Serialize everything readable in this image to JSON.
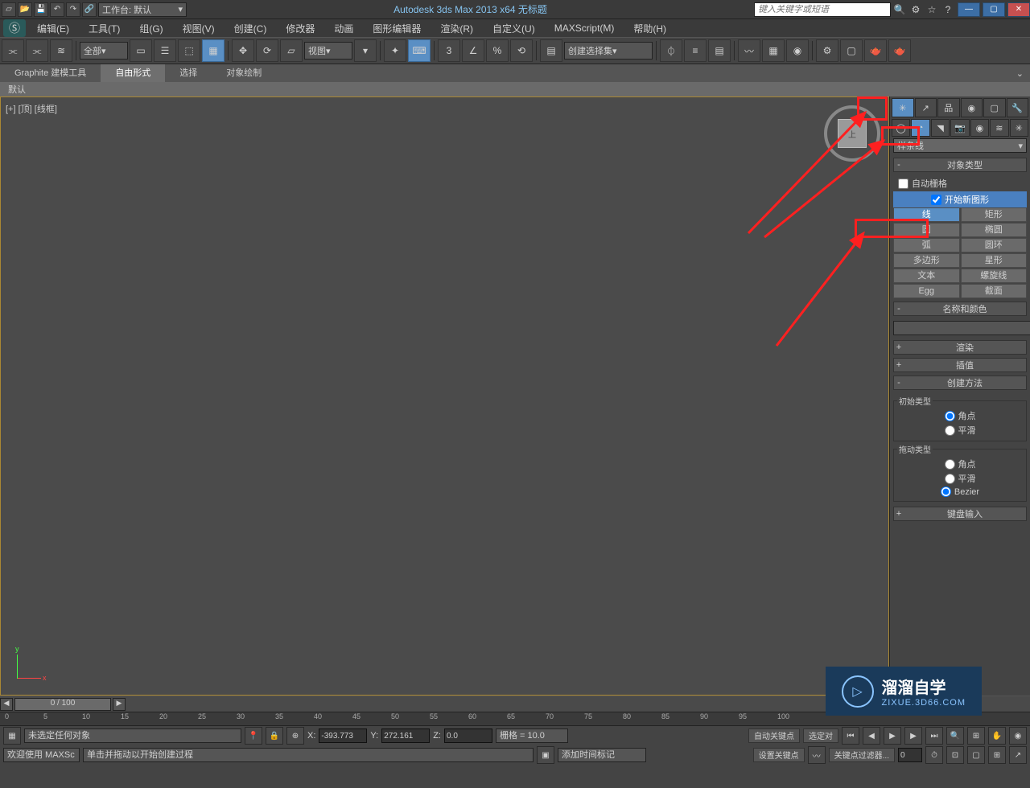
{
  "titlebar": {
    "workspace_label": "工作台: 默认",
    "app_title": "Autodesk 3ds Max  2013 x64     无标题",
    "search_placeholder": "键入关键字或短语"
  },
  "menubar": {
    "items": [
      "编辑(E)",
      "工具(T)",
      "组(G)",
      "视图(V)",
      "创建(C)",
      "修改器",
      "动画",
      "图形编辑器",
      "渲染(R)",
      "自定义(U)",
      "MAXScript(M)",
      "帮助(H)"
    ]
  },
  "toolbar": {
    "filter_all": "全部",
    "view_dd": "视图",
    "selset_dd": "创建选择集"
  },
  "ribbon": {
    "tabs": [
      "Graphite 建模工具",
      "自由形式",
      "选择",
      "对象绘制"
    ],
    "sub": "默认"
  },
  "viewport": {
    "label": "[+] [顶] [线框]",
    "cube_face": "上"
  },
  "panel": {
    "category_dd": "样条线",
    "rollouts": {
      "objtype": "对象类型",
      "autogrid": "自动栅格",
      "startnew": "开始新图形",
      "namecolor": "名称和颜色",
      "render": "渲染",
      "interp": "插值",
      "create_method": "创建方法",
      "keyboard": "键盘输入"
    },
    "objects": [
      "线",
      "矩形",
      "圆",
      "椭圆",
      "弧",
      "圆环",
      "多边形",
      "星形",
      "文本",
      "螺旋线",
      "Egg",
      "截面"
    ],
    "cm_initial": "初始类型",
    "cm_drag": "拖动类型",
    "cm_corner": "角点",
    "cm_smooth": "平滑",
    "cm_bezier": "Bezier"
  },
  "status": {
    "slider_frame": "0 / 100",
    "no_select": "未选定任何对象",
    "prompt_welcome": "欢迎使用 MAXSc",
    "prompt_create": "单击并拖动以开始创建过程",
    "x_label": "X:",
    "x_val": "-393.773",
    "y_label": "Y:",
    "y_val": "272.161",
    "z_label": "Z:",
    "z_val": "0.0",
    "grid": "栅格 = 10.0",
    "autokey": "自动关键点",
    "setkey": "设置关键点",
    "sel_lock": "选定对",
    "keyfilter": "关键点过滤器...",
    "add_time_tag": "添加时间标记"
  },
  "ruler_ticks": [
    "0",
    "5",
    "10",
    "15",
    "20",
    "25",
    "30",
    "35",
    "40",
    "45",
    "50",
    "55",
    "60",
    "65",
    "70",
    "75",
    "80",
    "85",
    "90",
    "95",
    "100"
  ],
  "watermark": {
    "title": "溜溜自学",
    "url": "ZIXUE.3D66.COM"
  }
}
